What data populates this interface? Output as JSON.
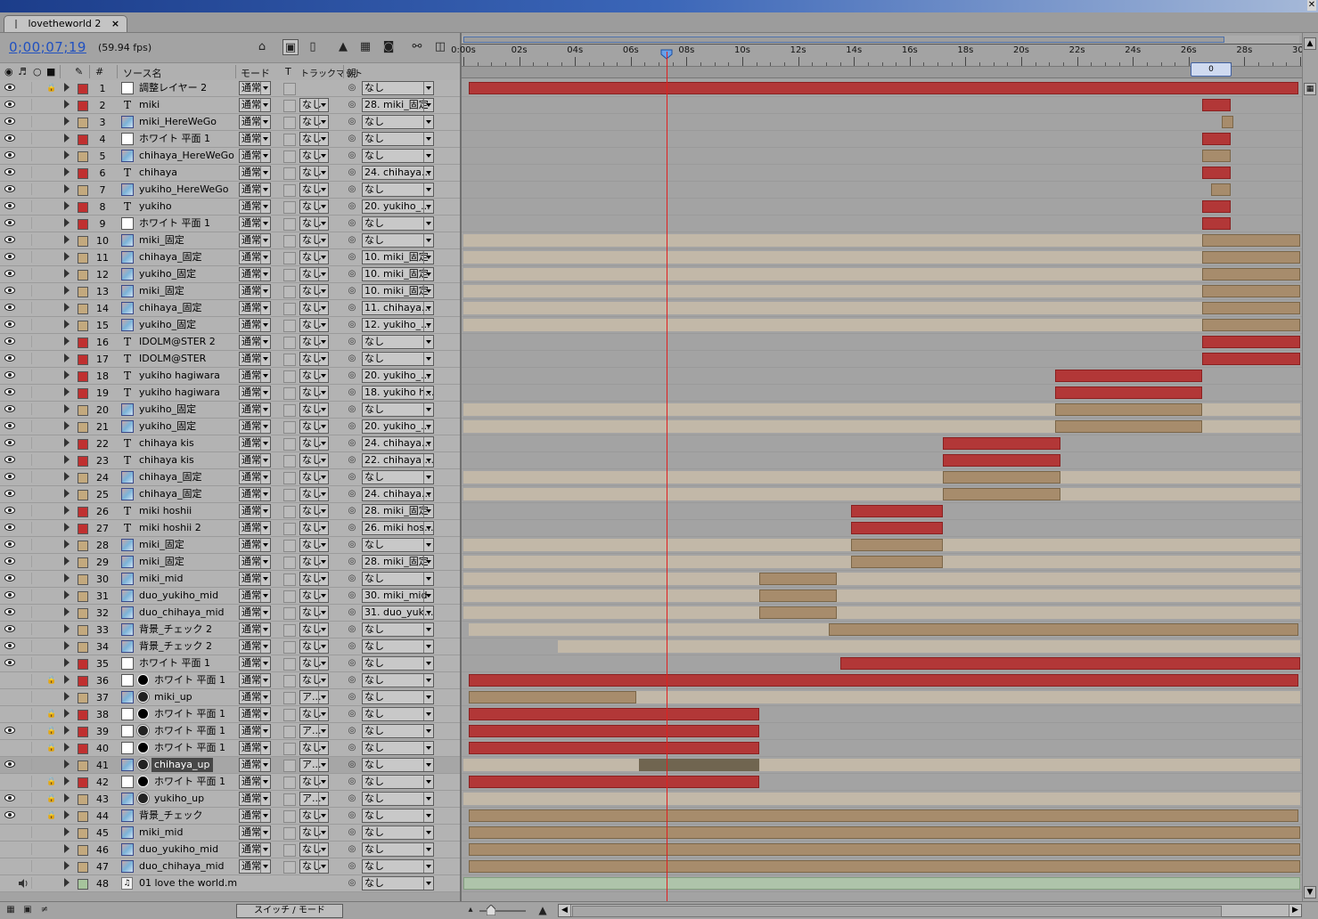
{
  "window": {
    "close_glyph": "✕"
  },
  "tab": {
    "title": "lovetheworld 2",
    "close": "×"
  },
  "time": {
    "timecode": "0;00;07;19",
    "fps": "(59.94 fps)"
  },
  "columns": {
    "num": "#",
    "source": "ソース名",
    "mode": "モード",
    "t": "T",
    "trkmat": "トラックマット",
    "parent": "親"
  },
  "ruler": {
    "ticks": [
      "0:00s",
      "02s",
      "04s",
      "06s",
      "08s",
      "10s",
      "12s",
      "14s",
      "16s",
      "18s",
      "20s",
      "22s",
      "24s",
      "26s",
      "28s",
      "30s"
    ],
    "current_time_s": 7.3,
    "end_marker": "0"
  },
  "timeline_span_s": 30,
  "colors": {
    "red": "#b23737",
    "tan": "#a78c6c",
    "beige": "#c2b8a8",
    "label_red": "#c03030",
    "label_tan": "#c3a97e",
    "label_green": "#a6c49c",
    "cti": "#e02020",
    "timecode": "#2050c0"
  },
  "icons": [
    "comp-flow-icon",
    "draft3d-icon",
    "frame-blending-icon",
    "motion-blur-icon",
    "brainstorm-icon",
    "graph-editor-icon",
    "live-update-icon",
    "shy-icon",
    "eye-icon",
    "audio-icon",
    "solo-icon",
    "lock-icon",
    "pickwhip-icon"
  ],
  "layers": [
    {
      "num": "1",
      "name": "調整レイヤー 2",
      "type": "solid",
      "label": "red",
      "mode": "通常",
      "trk": "",
      "parent": "なし",
      "lock": true,
      "eye": true,
      "bars": [
        {
          "s": 0.2,
          "e": 29.95,
          "c": "red"
        }
      ]
    },
    {
      "num": "2",
      "name": "miki",
      "type": "text",
      "label": "red",
      "mode": "通常",
      "trk": "なし",
      "parent": "28. miki_固定",
      "eye": true,
      "bars": [
        {
          "s": 26.5,
          "e": 27.5,
          "c": "red"
        }
      ]
    },
    {
      "num": "3",
      "name": "miki_HereWeGo",
      "type": "comp",
      "label": "tan",
      "mode": "通常",
      "trk": "なし",
      "parent": "なし",
      "eye": true,
      "bars": [
        {
          "s": 27.2,
          "e": 27.6,
          "c": "tan"
        }
      ]
    },
    {
      "num": "4",
      "name": "ホワイト 平面 1",
      "type": "solid",
      "label": "red",
      "mode": "通常",
      "trk": "なし",
      "parent": "なし",
      "eye": true,
      "bars": [
        {
          "s": 26.5,
          "e": 27.5,
          "c": "red"
        }
      ]
    },
    {
      "num": "5",
      "name": "chihaya_HereWeGo",
      "type": "comp",
      "label": "tan",
      "mode": "通常",
      "trk": "なし",
      "parent": "なし",
      "eye": true,
      "bars": [
        {
          "s": 26.5,
          "e": 27.5,
          "c": "tan"
        }
      ]
    },
    {
      "num": "6",
      "name": "chihaya",
      "type": "text",
      "label": "red",
      "mode": "通常",
      "trk": "なし",
      "parent": "24. chihaya...",
      "eye": true,
      "bars": [
        {
          "s": 26.5,
          "e": 27.5,
          "c": "red"
        }
      ]
    },
    {
      "num": "7",
      "name": "yukiho_HereWeGo",
      "type": "comp",
      "label": "tan",
      "mode": "通常",
      "trk": "なし",
      "parent": "なし",
      "eye": true,
      "bars": [
        {
          "s": 26.8,
          "e": 27.5,
          "c": "tan"
        }
      ]
    },
    {
      "num": "8",
      "name": "yukiho",
      "type": "text",
      "label": "red",
      "mode": "通常",
      "trk": "なし",
      "parent": "20. yukiho_...",
      "eye": true,
      "bars": [
        {
          "s": 26.5,
          "e": 27.5,
          "c": "red"
        }
      ]
    },
    {
      "num": "9",
      "name": "ホワイト 平面 1",
      "type": "solid",
      "label": "red",
      "mode": "通常",
      "trk": "なし",
      "parent": "なし",
      "eye": true,
      "bars": [
        {
          "s": 26.5,
          "e": 27.5,
          "c": "red"
        }
      ]
    },
    {
      "num": "10",
      "name": "miki_固定",
      "type": "comp",
      "label": "tan",
      "mode": "通常",
      "trk": "なし",
      "parent": "なし",
      "eye": true,
      "bars": [
        {
          "s": 0,
          "e": 26.5,
          "c": "beige"
        },
        {
          "s": 26.5,
          "e": 30,
          "c": "tan"
        }
      ]
    },
    {
      "num": "11",
      "name": "chihaya_固定",
      "type": "comp",
      "label": "tan",
      "mode": "通常",
      "trk": "なし",
      "parent": "10. miki_固定",
      "eye": true,
      "bars": [
        {
          "s": 0,
          "e": 26.5,
          "c": "beige"
        },
        {
          "s": 26.5,
          "e": 30,
          "c": "tan"
        }
      ]
    },
    {
      "num": "12",
      "name": "yukiho_固定",
      "type": "comp",
      "label": "tan",
      "mode": "通常",
      "trk": "なし",
      "parent": "10. miki_固定",
      "eye": true,
      "bars": [
        {
          "s": 0,
          "e": 26.5,
          "c": "beige"
        },
        {
          "s": 26.5,
          "e": 30,
          "c": "tan"
        }
      ]
    },
    {
      "num": "13",
      "name": "miki_固定",
      "type": "comp",
      "label": "tan",
      "mode": "通常",
      "trk": "なし",
      "parent": "10. miki_固定",
      "eye": true,
      "bars": [
        {
          "s": 0,
          "e": 26.5,
          "c": "beige"
        },
        {
          "s": 26.5,
          "e": 30,
          "c": "tan"
        }
      ]
    },
    {
      "num": "14",
      "name": "chihaya_固定",
      "type": "comp",
      "label": "tan",
      "mode": "通常",
      "trk": "なし",
      "parent": "11. chihaya...",
      "eye": true,
      "bars": [
        {
          "s": 0,
          "e": 26.5,
          "c": "beige"
        },
        {
          "s": 26.5,
          "e": 30,
          "c": "tan"
        }
      ]
    },
    {
      "num": "15",
      "name": "yukiho_固定",
      "type": "comp",
      "label": "tan",
      "mode": "通常",
      "trk": "なし",
      "parent": "12. yukiho_...",
      "eye": true,
      "bars": [
        {
          "s": 0,
          "e": 26.5,
          "c": "beige"
        },
        {
          "s": 26.5,
          "e": 30,
          "c": "tan"
        }
      ]
    },
    {
      "num": "16",
      "name": "IDOLM@STER 2",
      "type": "text",
      "label": "red",
      "mode": "通常",
      "trk": "なし",
      "parent": "なし",
      "eye": true,
      "bars": [
        {
          "s": 26.5,
          "e": 30,
          "c": "red"
        }
      ]
    },
    {
      "num": "17",
      "name": "IDOLM@STER",
      "type": "text",
      "label": "red",
      "mode": "通常",
      "trk": "なし",
      "parent": "なし",
      "eye": true,
      "bars": [
        {
          "s": 26.5,
          "e": 30,
          "c": "red"
        }
      ]
    },
    {
      "num": "18",
      "name": "yukiho hagiwara",
      "type": "text",
      "label": "red",
      "mode": "通常",
      "trk": "なし",
      "parent": "20. yukiho_...",
      "eye": true,
      "bars": [
        {
          "s": 21.2,
          "e": 26.5,
          "c": "red"
        }
      ]
    },
    {
      "num": "19",
      "name": "yukiho hagiwara",
      "type": "text",
      "label": "red",
      "mode": "通常",
      "trk": "なし",
      "parent": "18. yukiho h...",
      "eye": true,
      "bars": [
        {
          "s": 21.2,
          "e": 26.5,
          "c": "red"
        }
      ]
    },
    {
      "num": "20",
      "name": "yukiho_固定",
      "type": "comp",
      "label": "tan",
      "mode": "通常",
      "trk": "なし",
      "parent": "なし",
      "eye": true,
      "bars": [
        {
          "s": 0,
          "e": 21.2,
          "c": "beige"
        },
        {
          "s": 21.2,
          "e": 26.5,
          "c": "tan"
        },
        {
          "s": 26.5,
          "e": 30,
          "c": "beige"
        }
      ]
    },
    {
      "num": "21",
      "name": "yukiho_固定",
      "type": "comp",
      "label": "tan",
      "mode": "通常",
      "trk": "なし",
      "parent": "20. yukiho_...",
      "eye": true,
      "bars": [
        {
          "s": 0,
          "e": 21.2,
          "c": "beige"
        },
        {
          "s": 21.2,
          "e": 26.5,
          "c": "tan"
        },
        {
          "s": 26.5,
          "e": 30,
          "c": "beige"
        }
      ]
    },
    {
      "num": "22",
      "name": "chihaya          kis",
      "type": "text",
      "label": "red",
      "mode": "通常",
      "trk": "なし",
      "parent": "24. chihaya...",
      "eye": true,
      "bars": [
        {
          "s": 17.2,
          "e": 21.4,
          "c": "red"
        }
      ]
    },
    {
      "num": "23",
      "name": "chihaya          kis",
      "type": "text",
      "label": "red",
      "mode": "通常",
      "trk": "なし",
      "parent": "22. chihaya ...",
      "eye": true,
      "bars": [
        {
          "s": 17.2,
          "e": 21.4,
          "c": "red"
        }
      ]
    },
    {
      "num": "24",
      "name": "chihaya_固定",
      "type": "comp",
      "label": "tan",
      "mode": "通常",
      "trk": "なし",
      "parent": "なし",
      "eye": true,
      "bars": [
        {
          "s": 0,
          "e": 17.2,
          "c": "beige"
        },
        {
          "s": 17.2,
          "e": 21.4,
          "c": "tan"
        },
        {
          "s": 21.4,
          "e": 30,
          "c": "beige"
        }
      ]
    },
    {
      "num": "25",
      "name": "chihaya_固定",
      "type": "comp",
      "label": "tan",
      "mode": "通常",
      "trk": "なし",
      "parent": "24. chihaya...",
      "eye": true,
      "bars": [
        {
          "s": 0,
          "e": 17.2,
          "c": "beige"
        },
        {
          "s": 17.2,
          "e": 21.4,
          "c": "tan"
        },
        {
          "s": 21.4,
          "e": 30,
          "c": "beige"
        }
      ]
    },
    {
      "num": "26",
      "name": "miki hoshii",
      "type": "text",
      "label": "red",
      "mode": "通常",
      "trk": "なし",
      "parent": "28. miki_固定",
      "eye": true,
      "bars": [
        {
          "s": 13.9,
          "e": 17.2,
          "c": "red"
        }
      ]
    },
    {
      "num": "27",
      "name": "miki hoshii 2",
      "type": "text",
      "label": "red",
      "mode": "通常",
      "trk": "なし",
      "parent": "26. miki hos...",
      "eye": true,
      "bars": [
        {
          "s": 13.9,
          "e": 17.2,
          "c": "red"
        }
      ]
    },
    {
      "num": "28",
      "name": "miki_固定",
      "type": "comp",
      "label": "tan",
      "mode": "通常",
      "trk": "なし",
      "parent": "なし",
      "eye": true,
      "bars": [
        {
          "s": 0,
          "e": 13.9,
          "c": "beige"
        },
        {
          "s": 13.9,
          "e": 17.2,
          "c": "tan"
        },
        {
          "s": 17.2,
          "e": 30,
          "c": "beige"
        }
      ]
    },
    {
      "num": "29",
      "name": "miki_固定",
      "type": "comp",
      "label": "tan",
      "mode": "通常",
      "trk": "なし",
      "parent": "28. miki_固定",
      "eye": true,
      "bars": [
        {
          "s": 0,
          "e": 13.9,
          "c": "beige"
        },
        {
          "s": 13.9,
          "e": 17.2,
          "c": "tan"
        },
        {
          "s": 17.2,
          "e": 30,
          "c": "beige"
        }
      ]
    },
    {
      "num": "30",
      "name": "miki_mid",
      "type": "comp",
      "label": "tan",
      "mode": "通常",
      "trk": "なし",
      "parent": "なし",
      "eye": true,
      "bars": [
        {
          "s": 0,
          "e": 10.6,
          "c": "beige"
        },
        {
          "s": 10.6,
          "e": 13.4,
          "c": "tan"
        },
        {
          "s": 13.4,
          "e": 30,
          "c": "beige"
        }
      ]
    },
    {
      "num": "31",
      "name": "duo_yukiho_mid",
      "type": "comp",
      "label": "tan",
      "mode": "通常",
      "trk": "なし",
      "parent": "30. miki_mid",
      "eye": true,
      "bars": [
        {
          "s": 0,
          "e": 10.6,
          "c": "beige"
        },
        {
          "s": 10.6,
          "e": 13.4,
          "c": "tan"
        },
        {
          "s": 13.4,
          "e": 30,
          "c": "beige"
        }
      ]
    },
    {
      "num": "32",
      "name": "duo_chihaya_mid",
      "type": "comp",
      "label": "tan",
      "mode": "通常",
      "trk": "なし",
      "parent": "31. duo_yuk...",
      "eye": true,
      "bars": [
        {
          "s": 0,
          "e": 10.6,
          "c": "beige"
        },
        {
          "s": 10.6,
          "e": 13.4,
          "c": "tan"
        },
        {
          "s": 13.4,
          "e": 30,
          "c": "beige"
        }
      ]
    },
    {
      "num": "33",
      "name": "背景_チェック 2",
      "type": "comp",
      "label": "tan",
      "mode": "通常",
      "trk": "なし",
      "parent": "なし",
      "eye": true,
      "bars": [
        {
          "s": 0.2,
          "e": 13.1,
          "c": "beige"
        },
        {
          "s": 13.1,
          "e": 29.95,
          "c": "tan"
        }
      ]
    },
    {
      "num": "34",
      "name": "背景_チェック 2",
      "type": "comp",
      "label": "tan",
      "mode": "通常",
      "trk": "なし",
      "parent": "なし",
      "eye": true,
      "bars": [
        {
          "s": 3.4,
          "e": 30,
          "c": "beige"
        }
      ]
    },
    {
      "num": "35",
      "name": "ホワイト 平面 1",
      "type": "solid",
      "label": "red",
      "mode": "通常",
      "trk": "なし",
      "parent": "なし",
      "eye": true,
      "bars": [
        {
          "s": 13.5,
          "e": 30,
          "c": "red"
        }
      ]
    },
    {
      "num": "36",
      "name": "ホワイト 平面 1",
      "type": "solid",
      "label": "red",
      "mode": "通常",
      "trk": "なし",
      "parent": "なし",
      "lock": true,
      "mask": "black",
      "bars": [
        {
          "s": 0.2,
          "e": 29.95,
          "c": "red"
        }
      ]
    },
    {
      "num": "37",
      "name": "miki_up",
      "type": "comp",
      "label": "tan",
      "mode": "通常",
      "trk": "ア...",
      "parent": "なし",
      "mask": "ring",
      "bars": [
        {
          "s": 0.2,
          "e": 6.2,
          "c": "tan"
        },
        {
          "s": 6.2,
          "e": 30,
          "c": "beige"
        }
      ]
    },
    {
      "num": "38",
      "name": "ホワイト 平面 1",
      "type": "solid",
      "label": "red",
      "mode": "通常",
      "trk": "なし",
      "parent": "なし",
      "lock": true,
      "mask": "black",
      "bars": [
        {
          "s": 0.2,
          "e": 10.6,
          "c": "red"
        }
      ]
    },
    {
      "num": "39",
      "name": "ホワイト 平面 1",
      "type": "solid",
      "label": "red",
      "mode": "通常",
      "trk": "ア...",
      "parent": "なし",
      "lock": true,
      "eye": true,
      "mask": "ring",
      "bars": [
        {
          "s": 0.2,
          "e": 10.6,
          "c": "red"
        }
      ]
    },
    {
      "num": "40",
      "name": "ホワイト 平面 1",
      "type": "solid",
      "label": "red",
      "mode": "通常",
      "trk": "なし",
      "parent": "なし",
      "lock": true,
      "mask": "black",
      "bars": [
        {
          "s": 0.2,
          "e": 10.6,
          "c": "red"
        }
      ]
    },
    {
      "num": "41",
      "name": "chihaya_up",
      "type": "comp",
      "label": "tan",
      "mode": "通常",
      "trk": "ア...",
      "parent": "なし",
      "eye": true,
      "mask": "ring",
      "selected": true,
      "bars": [
        {
          "s": 0,
          "e": 6.3,
          "c": "beige"
        },
        {
          "s": 6.3,
          "e": 10.6,
          "c": "dark"
        },
        {
          "s": 10.6,
          "e": 30,
          "c": "beige"
        }
      ]
    },
    {
      "num": "42",
      "name": "ホワイト 平面 1",
      "type": "solid",
      "label": "red",
      "mode": "通常",
      "trk": "なし",
      "parent": "なし",
      "lock": true,
      "mask": "black",
      "bars": [
        {
          "s": 0.2,
          "e": 10.6,
          "c": "red"
        }
      ]
    },
    {
      "num": "43",
      "name": "yukiho_up",
      "type": "comp",
      "label": "tan",
      "mode": "通常",
      "trk": "ア...",
      "parent": "なし",
      "lock": true,
      "eye": true,
      "mask": "ring",
      "bars": [
        {
          "s": 0,
          "e": 6.3,
          "c": "beige"
        },
        {
          "s": 6.3,
          "e": 10.6,
          "c": "beige"
        },
        {
          "s": 10.6,
          "e": 30,
          "c": "beige"
        }
      ]
    },
    {
      "num": "44",
      "name": "背景_チェック",
      "type": "comp",
      "label": "tan",
      "mode": "通常",
      "trk": "なし",
      "parent": "なし",
      "lock": true,
      "eye": true,
      "bars": [
        {
          "s": 0.2,
          "e": 29.95,
          "c": "tan"
        }
      ]
    },
    {
      "num": "45",
      "name": "miki_mid",
      "type": "comp",
      "label": "tan",
      "mode": "通常",
      "trk": "なし",
      "parent": "なし",
      "bars": [
        {
          "s": 0.2,
          "e": 30,
          "c": "tan"
        }
      ]
    },
    {
      "num": "46",
      "name": "duo_yukiho_mid",
      "type": "comp",
      "label": "tan",
      "mode": "通常",
      "trk": "なし",
      "parent": "なし",
      "bars": [
        {
          "s": 0.2,
          "e": 30,
          "c": "tan"
        }
      ]
    },
    {
      "num": "47",
      "name": "duo_chihaya_mid",
      "type": "comp",
      "label": "tan",
      "mode": "通常",
      "trk": "なし",
      "parent": "なし",
      "bars": [
        {
          "s": 0.2,
          "e": 30,
          "c": "tan"
        }
      ]
    },
    {
      "num": "48",
      "name": "01 love the world.m",
      "type": "audio",
      "label": "green",
      "mode": "",
      "trk": "",
      "parent": "なし",
      "audio": true,
      "bars": [
        {
          "s": 0,
          "e": 30,
          "c": "audio"
        }
      ]
    }
  ],
  "bottom": {
    "switch_mode": "スイッチ / モード"
  }
}
